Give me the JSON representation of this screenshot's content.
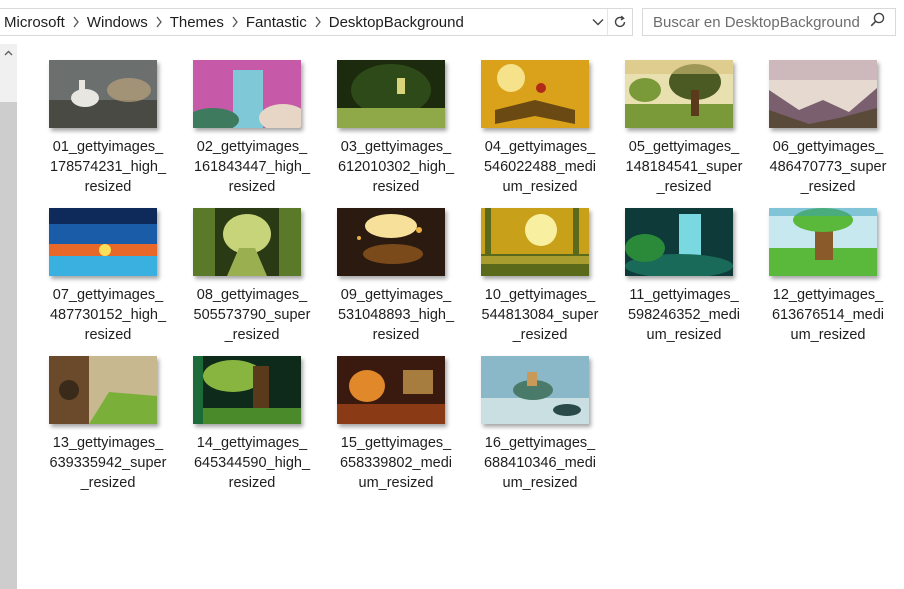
{
  "address_bar": {
    "crumbs": [
      "Microsoft",
      "Windows",
      "Themes",
      "Fantastic",
      "DesktopBackground"
    ]
  },
  "search": {
    "placeholder": "Buscar en DesktopBackground"
  },
  "files": [
    {
      "name_lines": [
        "01_gettyimages_",
        "178574231_high_",
        "resized"
      ],
      "palette": [
        "#6b6f6e",
        "#b9a27a",
        "#e8e6e0",
        "#4a4a44"
      ],
      "scene": "unicorn"
    },
    {
      "name_lines": [
        "02_gettyimages_",
        "161843447_high_",
        "resized"
      ],
      "palette": [
        "#c65aa8",
        "#7ec8d8",
        "#e7d6c5",
        "#3e7a5e"
      ],
      "scene": "waterfall"
    },
    {
      "name_lines": [
        "03_gettyimages_",
        "612010302_high_",
        "resized"
      ],
      "palette": [
        "#2e4a18",
        "#8fa848",
        "#d9d37a",
        "#1c2a0e"
      ],
      "scene": "forestdoor"
    },
    {
      "name_lines": [
        "04_gettyimages_",
        "546022488_medi",
        "um_resized"
      ],
      "palette": [
        "#d9a21a",
        "#f6e28a",
        "#6a4a12",
        "#b02a1a"
      ],
      "scene": "book"
    },
    {
      "name_lines": [
        "05_gettyimages_",
        "148184541_super",
        "_resized"
      ],
      "palette": [
        "#d8c07a",
        "#7a9a3a",
        "#4a5a22",
        "#e9e0b0"
      ],
      "scene": "tree"
    },
    {
      "name_lines": [
        "06_gettyimages_",
        "486470773_super",
        "_resized"
      ],
      "palette": [
        "#c2a9b3",
        "#7a5f6e",
        "#e6d9d0",
        "#5a4a3a"
      ],
      "scene": "valley"
    },
    {
      "name_lines": [
        "07_gettyimages_",
        "487730152_high_",
        "resized"
      ],
      "palette": [
        "#1a5ca8",
        "#e8682a",
        "#3ab0e0",
        "#0e2a5a"
      ],
      "scene": "sunset"
    },
    {
      "name_lines": [
        "08_gettyimages_",
        "505573790_super",
        "_resized"
      ],
      "palette": [
        "#5a7a2a",
        "#c8d47a",
        "#2a3a14",
        "#9ab050"
      ],
      "scene": "steps"
    },
    {
      "name_lines": [
        "09_gettyimages_",
        "531048893_high_",
        "resized"
      ],
      "palette": [
        "#2a1a10",
        "#e8b040",
        "#7a4a1a",
        "#f6e09a"
      ],
      "scene": "cave"
    },
    {
      "name_lines": [
        "10_gettyimages_",
        "544813084_super",
        "_resized"
      ],
      "palette": [
        "#c8a01a",
        "#f8f0a0",
        "#5a6a1a",
        "#e0c040"
      ],
      "scene": "sunforest"
    },
    {
      "name_lines": [
        "11_gettyimages_",
        "598246352_medi",
        "um_resized"
      ],
      "palette": [
        "#1a6a5a",
        "#7ad8e0",
        "#2a8a3a",
        "#0e3a3a"
      ],
      "scene": "falls"
    },
    {
      "name_lines": [
        "12_gettyimages_",
        "613676514_medi",
        "um_resized"
      ],
      "palette": [
        "#3aa0c0",
        "#5ab83a",
        "#8a5a2a",
        "#c8e8f0"
      ],
      "scene": "cartoon"
    },
    {
      "name_lines": [
        "13_gettyimages_",
        "639335942_super",
        "_resized"
      ],
      "palette": [
        "#6a4a2a",
        "#7ab03a",
        "#c8b890",
        "#3a2a1a"
      ],
      "scene": "hut"
    },
    {
      "name_lines": [
        "14_gettyimages_",
        "645344590_high_",
        "resized"
      ],
      "palette": [
        "#1a6a3a",
        "#a8d84a",
        "#4a8a2a",
        "#0e2a1a"
      ],
      "scene": "glow"
    },
    {
      "name_lines": [
        "15_gettyimages_",
        "658339802_medi",
        "um_resized"
      ],
      "palette": [
        "#3a1a0e",
        "#e0882a",
        "#8a3a14",
        "#f0c060"
      ],
      "scene": "room"
    },
    {
      "name_lines": [
        "16_gettyimages_",
        "688410346_medi",
        "um_resized"
      ],
      "palette": [
        "#8ab8c8",
        "#d8e8e8",
        "#4a7a6a",
        "#2a4a4a"
      ],
      "scene": "island"
    }
  ]
}
